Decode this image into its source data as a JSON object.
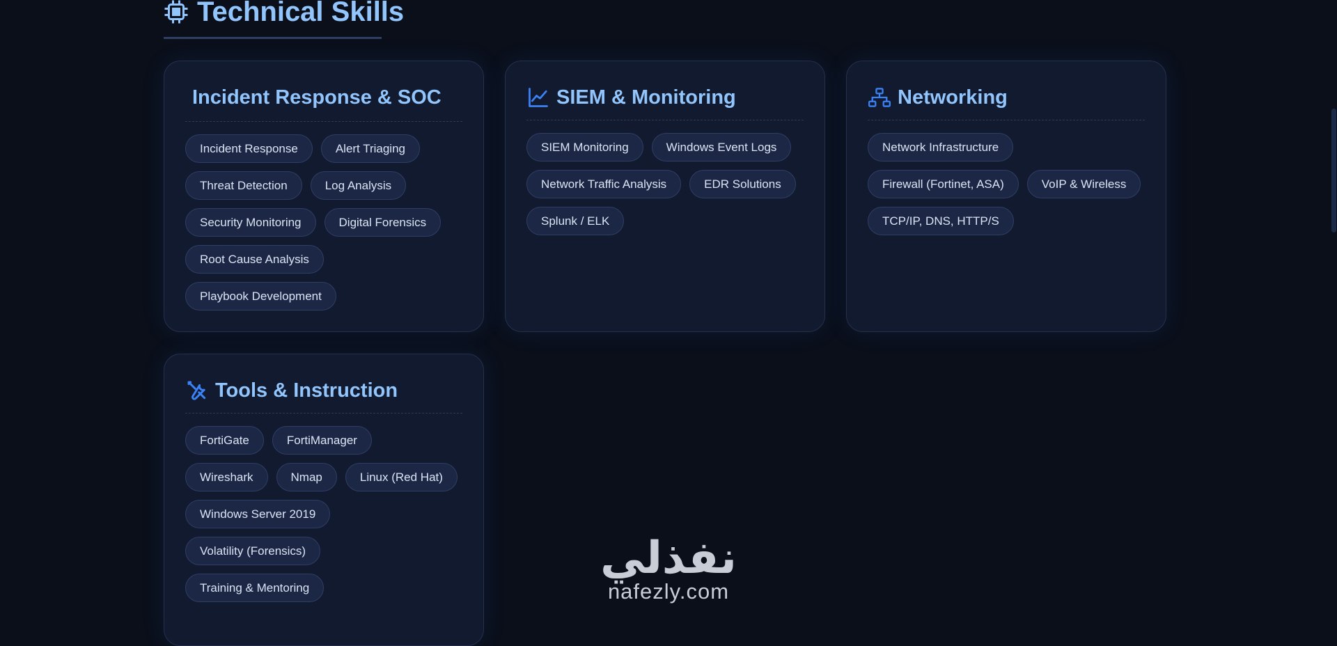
{
  "section": {
    "title": "Technical Skills",
    "icon": "cpu-chip-icon"
  },
  "cards": [
    {
      "title": "Incident Response & SOC",
      "icon": "",
      "tags": [
        "Incident Response",
        "Alert Triaging",
        "Threat Detection",
        "Log Analysis",
        "Security Monitoring",
        "Digital Forensics",
        "Root Cause Analysis",
        "Playbook Development"
      ]
    },
    {
      "title": "SIEM & Monitoring",
      "icon": "line-chart-icon",
      "tags": [
        "SIEM Monitoring",
        "Windows Event Logs",
        "Network Traffic Analysis",
        "EDR Solutions",
        "Splunk / ELK"
      ]
    },
    {
      "title": "Networking",
      "icon": "network-topology-icon",
      "tags": [
        "Network Infrastructure",
        "Firewall (Fortinet, ASA)",
        "VoIP & Wireless",
        "TCP/IP, DNS, HTTP/S"
      ]
    },
    {
      "title": "Tools & Instruction",
      "icon": "tools-icon",
      "tags": [
        "FortiGate",
        "FortiManager",
        "Wireshark",
        "Nmap",
        "Linux (Red Hat)",
        "Windows Server 2019",
        "Volatility (Forensics)",
        "Training & Mentoring"
      ]
    }
  ],
  "watermark": {
    "arabic": "نفذلي",
    "latin": "nafezly.com"
  },
  "colors": {
    "background": "#0a0f1a",
    "card": "#111a2e",
    "accent": "#93c5fd",
    "icon": "#3b82f6",
    "tag": "#1c2745"
  }
}
